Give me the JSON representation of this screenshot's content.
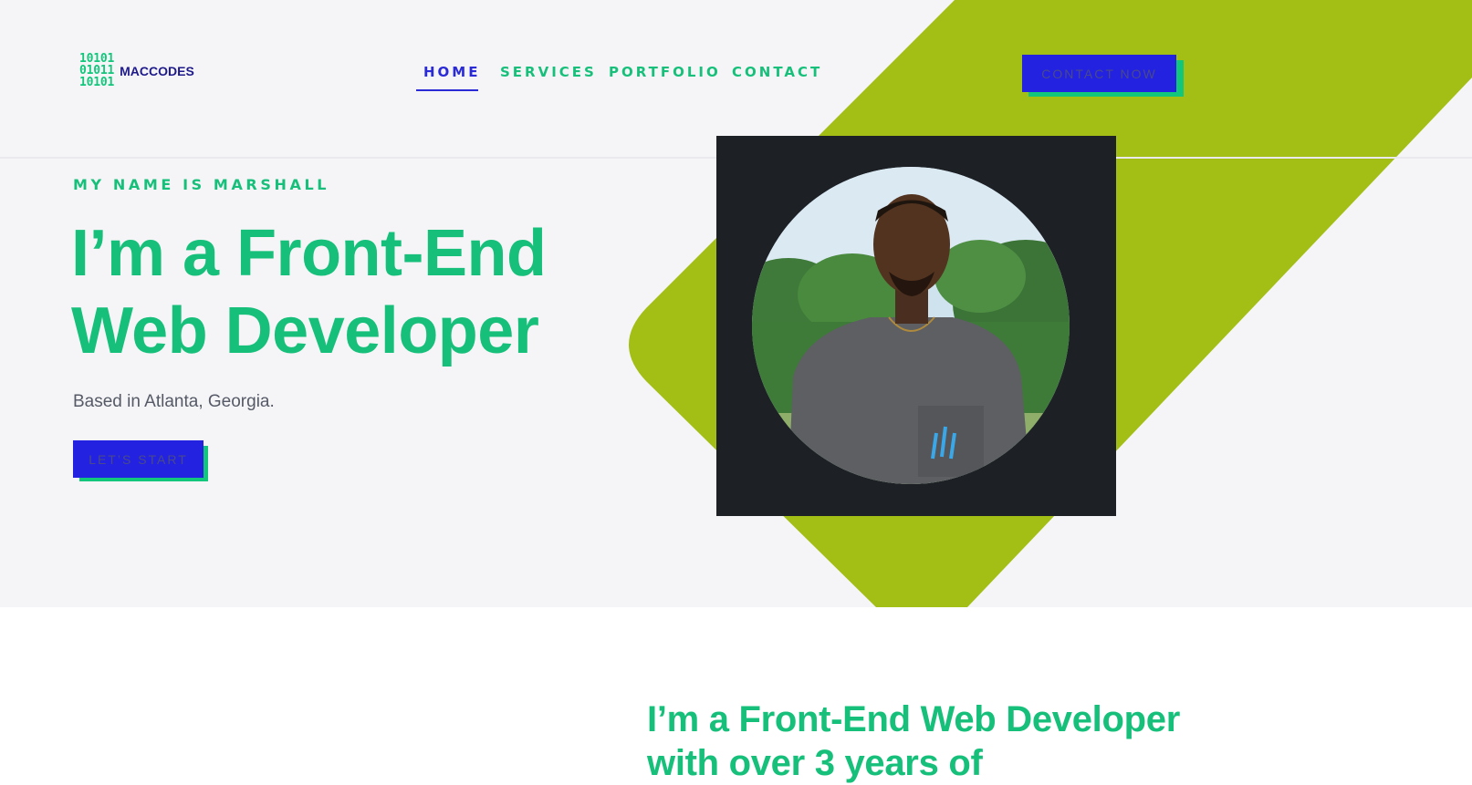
{
  "brand": {
    "logo_bits": [
      "10101",
      "01011",
      "10101"
    ],
    "name": "MACCODES"
  },
  "nav": {
    "items": [
      {
        "label": "HOME",
        "active": true
      },
      {
        "label": "SERVICES",
        "active": false
      },
      {
        "label": "PORTFOLIO",
        "active": false
      },
      {
        "label": "CONTACT",
        "active": false
      }
    ],
    "cta_label": "CONTACT NOW"
  },
  "hero": {
    "eyebrow": "MY NAME IS MARSHALL",
    "headline_line1": "I’m a Front-End",
    "headline_line2": "Web Developer",
    "subtext": "Based in Atlanta, Georgia.",
    "cta_label": "LET’S START"
  },
  "about": {
    "title_line1": "I’m a Front-End Web Developer",
    "title_line2": "with over 3 years of"
  },
  "colors": {
    "accent_green": "#17c07a",
    "lime_band": "#a3be14",
    "primary_blue": "#2222e0",
    "nav_active": "#2a2ad6",
    "logo_navy": "#1e1a8a",
    "photo_frame": "#1d2126",
    "hero_bg": "#f5f5f8"
  }
}
